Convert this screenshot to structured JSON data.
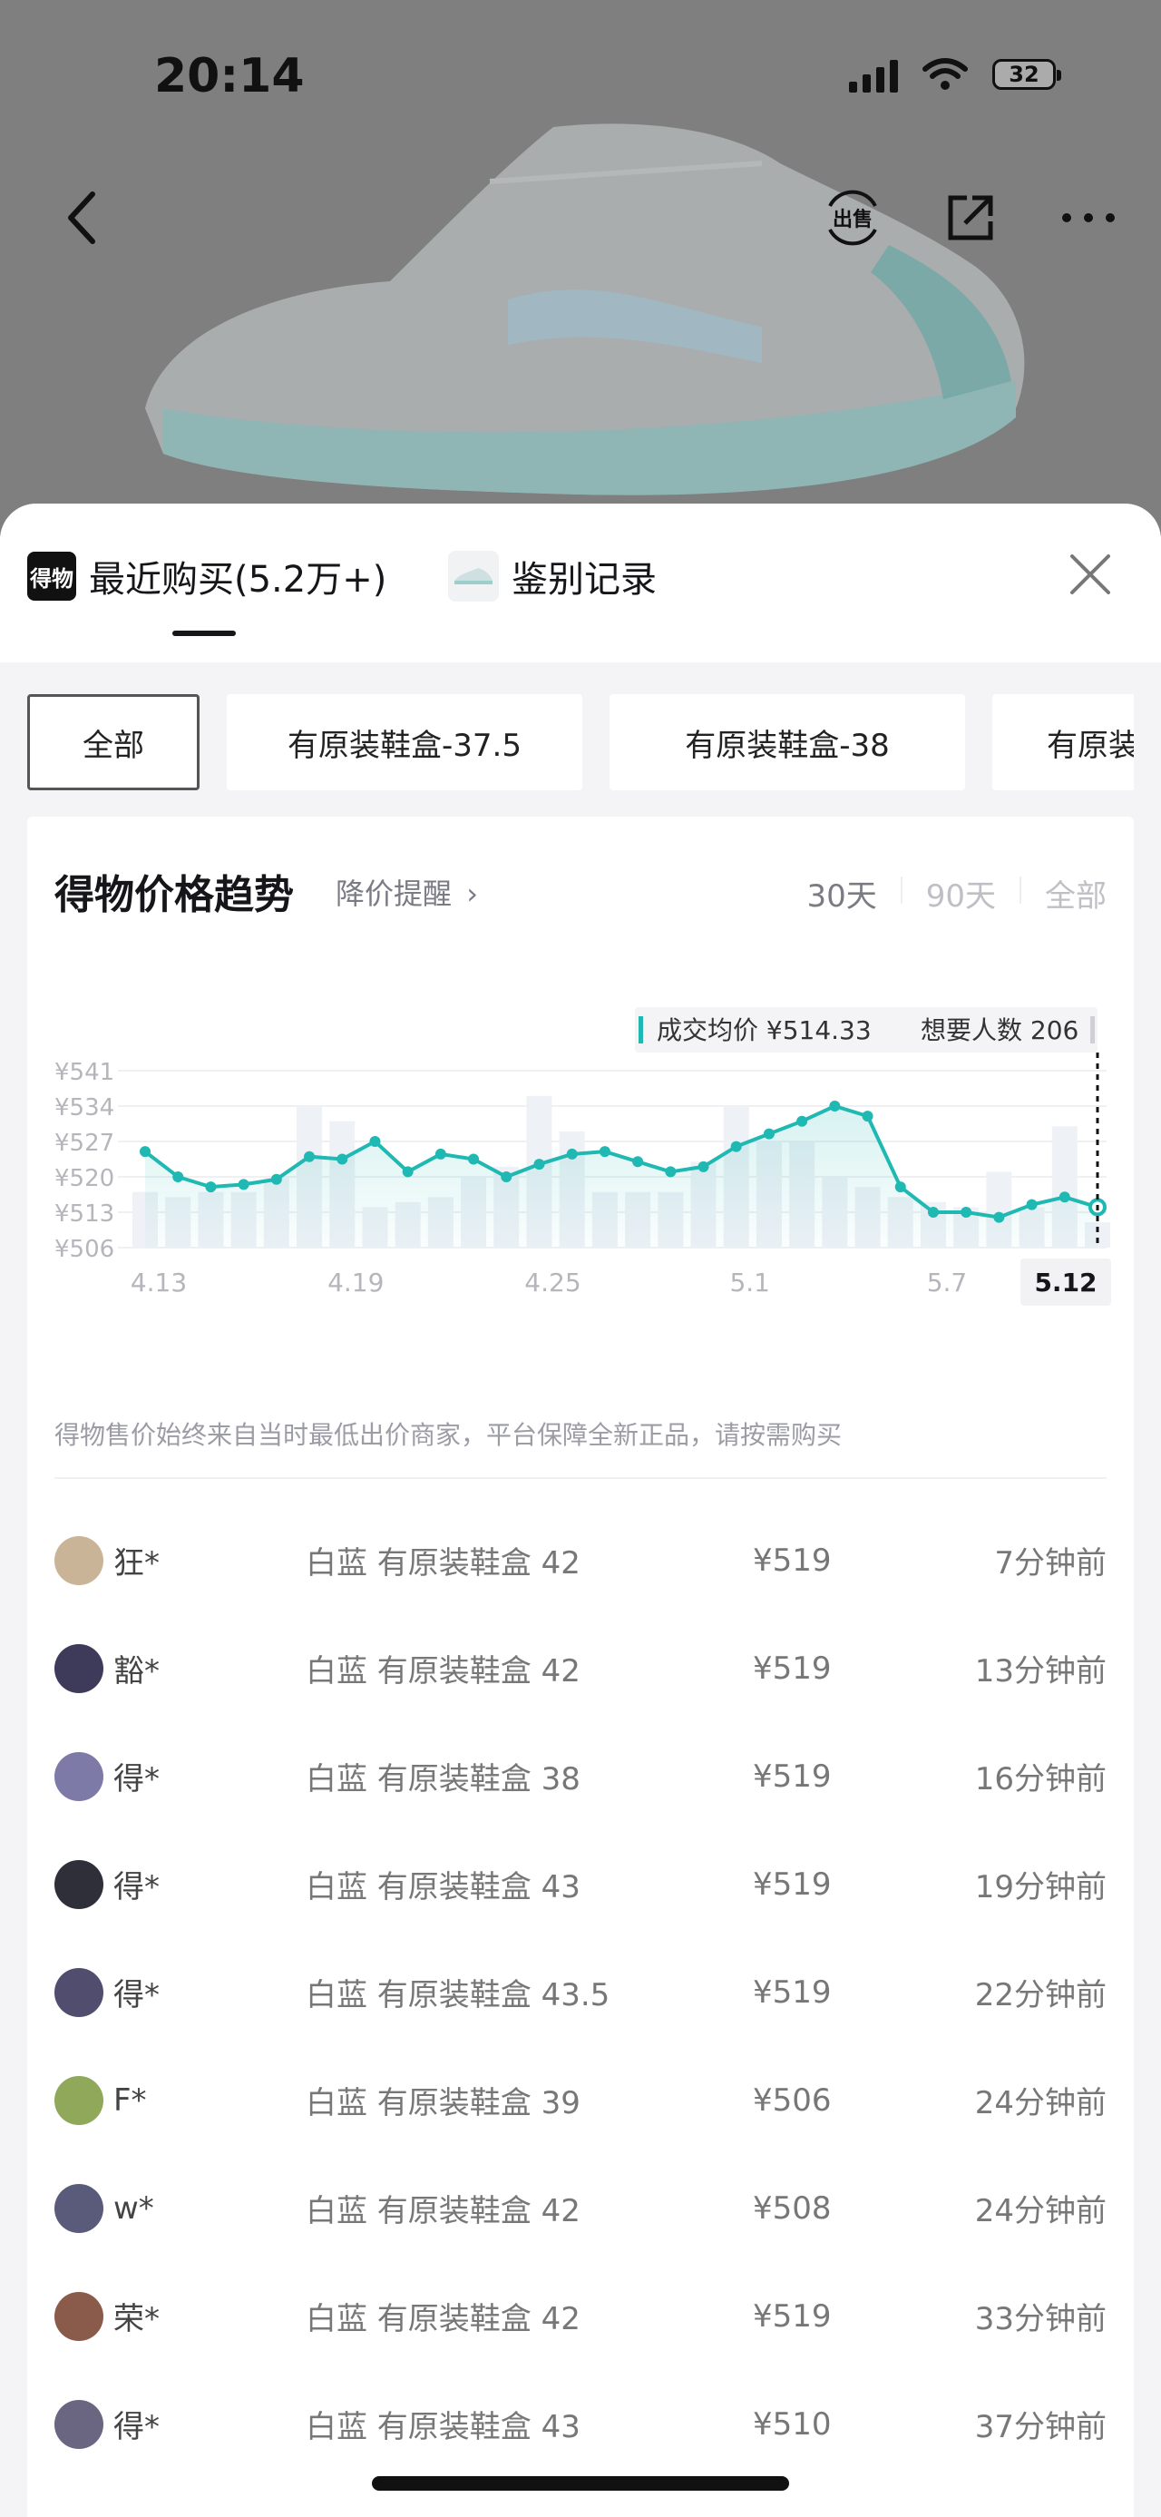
{
  "status_bar": {
    "time": "20:14",
    "battery": "32"
  },
  "hero_actions": {
    "sell_label": "出售"
  },
  "sheet": {
    "tabs": [
      {
        "label": "最近购买(5.2万+)",
        "logo": "得物"
      },
      {
        "label": "鉴别记录"
      }
    ],
    "filters": [
      "全部",
      "有原装鞋盒-37.5",
      "有原装鞋盒-38",
      "有原装鞋盒"
    ],
    "card": {
      "title": "得物价格趋势",
      "price_alert": "降价提醒",
      "ranges": [
        "30天",
        "90天",
        "全部"
      ],
      "note": "得物售价始终来自当时最低出价商家，平台保障全新正品，请按需购买"
    },
    "sales": [
      {
        "user": "狂*",
        "spec": "白蓝 有原装鞋盒 42",
        "price": "¥519",
        "time": "7分钟前",
        "avatar_color": "#c9b497"
      },
      {
        "user": "豁*",
        "spec": "白蓝 有原装鞋盒 42",
        "price": "¥519",
        "time": "13分钟前",
        "avatar_color": "#3d3a5a"
      },
      {
        "user": "得*",
        "spec": "白蓝 有原装鞋盒 38",
        "price": "¥519",
        "time": "16分钟前",
        "avatar_color": "#7d7aa8"
      },
      {
        "user": "得*",
        "spec": "白蓝 有原装鞋盒 43",
        "price": "¥519",
        "time": "19分钟前",
        "avatar_color": "#2f2f3a"
      },
      {
        "user": "得*",
        "spec": "白蓝 有原装鞋盒 43.5",
        "price": "¥519",
        "time": "22分钟前",
        "avatar_color": "#504d6e"
      },
      {
        "user": "F*",
        "spec": "白蓝 有原装鞋盒 39",
        "price": "¥506",
        "time": "24分钟前",
        "avatar_color": "#8fa85a"
      },
      {
        "user": "w*",
        "spec": "白蓝 有原装鞋盒 42",
        "price": "¥508",
        "time": "24分钟前",
        "avatar_color": "#5a5a7a"
      },
      {
        "user": "荣*",
        "spec": "白蓝 有原装鞋盒 42",
        "price": "¥519",
        "time": "33分钟前",
        "avatar_color": "#8a5a4a"
      },
      {
        "user": "得*",
        "spec": "白蓝 有原装鞋盒 43",
        "price": "¥510",
        "time": "37分钟前",
        "avatar_color": "#6a6580"
      }
    ]
  },
  "chart_data": {
    "type": "line",
    "y_ticks": [
      "¥541",
      "¥534",
      "¥527",
      "¥520",
      "¥513",
      "¥506"
    ],
    "ylim": [
      506,
      541
    ],
    "x_ticks": [
      "4.13",
      "4.19",
      "4.25",
      "5.1",
      "5.7",
      "5.12"
    ],
    "highlight_label": "5.12",
    "tooltip": {
      "avg_label": "成交均价 ¥514.33",
      "want_label": "想要人数 206"
    },
    "line_color": "#1fb8b2",
    "series": [
      {
        "values": [
          525,
          520,
          518,
          518.5,
          519.5,
          524,
          523.5,
          527,
          521,
          524.5,
          523.5,
          520,
          522.5,
          524.5,
          525,
          523,
          521,
          522,
          526,
          528.5,
          531,
          534,
          532,
          518,
          513,
          513,
          512,
          514.5,
          516,
          514
        ]
      }
    ],
    "bar_values": [
      517,
      516,
      517,
      517,
      520,
      534,
      531,
      514,
      515,
      516,
      520,
      522,
      536,
      529,
      517,
      517,
      517,
      523,
      534,
      527,
      527,
      520,
      518,
      516,
      515,
      514,
      521,
      514,
      530,
      511
    ]
  }
}
